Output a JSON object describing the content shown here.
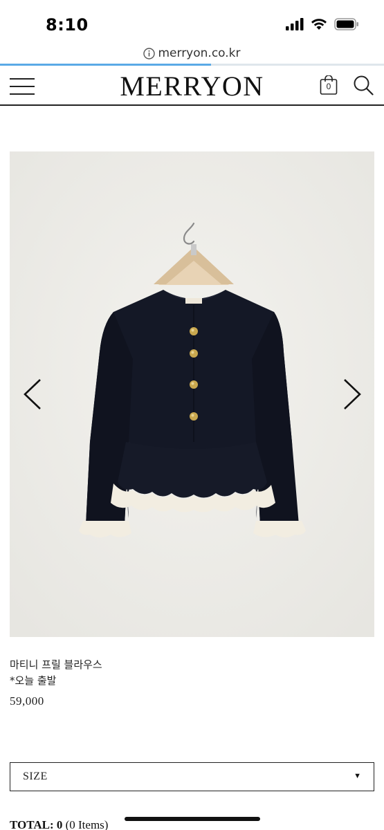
{
  "status_bar": {
    "time": "8:10",
    "icons": [
      "signal-icon",
      "wifi-icon",
      "battery-icon"
    ]
  },
  "browser": {
    "url": "merryon.co.kr",
    "url_icon": "info-icon",
    "load_progress": 0.55
  },
  "header": {
    "logo": "MERRYON",
    "menu_icon": "hamburger-menu-icon",
    "cart_icon": "shopping-bag-icon",
    "cart_count": "0",
    "search_icon": "search-icon"
  },
  "gallery": {
    "image_subject": "navy-peplum-jacket-with-ivory-ruffle-trim",
    "prev_icon": "chevron-left-icon",
    "next_icon": "chevron-right-icon"
  },
  "product": {
    "name": "마티니 프릴 블라우스",
    "note": "*오늘 출발",
    "price": "59,000"
  },
  "options": {
    "size_label": "SIZE",
    "caret": "▼"
  },
  "summary": {
    "total_label": "TOTAL:",
    "total_value": "0",
    "items_text": "(0 Items)"
  },
  "colors": {
    "accent_progress": "#5aa9e6",
    "jacket": "#141826",
    "ruffle": "#f2ede1",
    "photo_bg": "#eeede9"
  }
}
